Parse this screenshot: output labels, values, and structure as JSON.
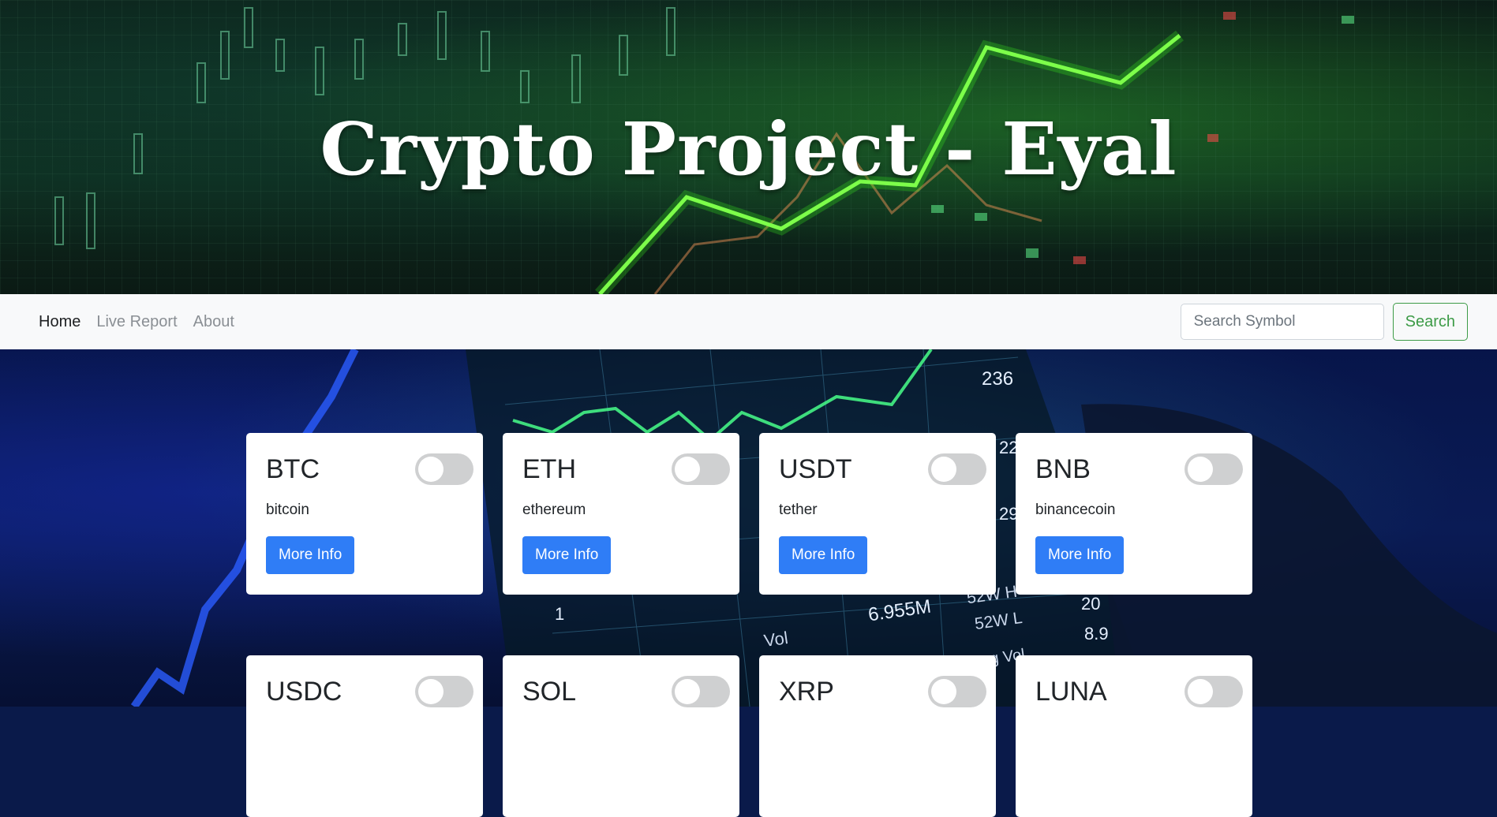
{
  "hero": {
    "title": "Crypto Project - Eyal"
  },
  "nav": {
    "links": [
      {
        "label": "Home",
        "active": true
      },
      {
        "label": "Live Report",
        "active": false
      },
      {
        "label": "About",
        "active": false
      }
    ],
    "search_placeholder": "Search Symbol",
    "search_button": "Search"
  },
  "background_readouts": [
    "236",
    "22",
    "29",
    "1",
    "6.955M",
    "Vol",
    "52W H",
    "52W L",
    "20",
    "8.9",
    "wg Vol"
  ],
  "cards": [
    {
      "symbol": "BTC",
      "name": "bitcoin",
      "button": "More Info",
      "toggled": false
    },
    {
      "symbol": "ETH",
      "name": "ethereum",
      "button": "More Info",
      "toggled": false
    },
    {
      "symbol": "USDT",
      "name": "tether",
      "button": "More Info",
      "toggled": false
    },
    {
      "symbol": "BNB",
      "name": "binancecoin",
      "button": "More Info",
      "toggled": false
    },
    {
      "symbol": "USDC",
      "name": "",
      "button": "",
      "toggled": false
    },
    {
      "symbol": "SOL",
      "name": "",
      "button": "",
      "toggled": false
    },
    {
      "symbol": "XRP",
      "name": "",
      "button": "",
      "toggled": false
    },
    {
      "symbol": "LUNA",
      "name": "",
      "button": "",
      "toggled": false
    }
  ],
  "colors": {
    "primary_button": "#2f7df6",
    "search_outline": "#3d9b47",
    "navbar_bg": "#f8f9fa",
    "chart_green": "#7dff4a"
  }
}
